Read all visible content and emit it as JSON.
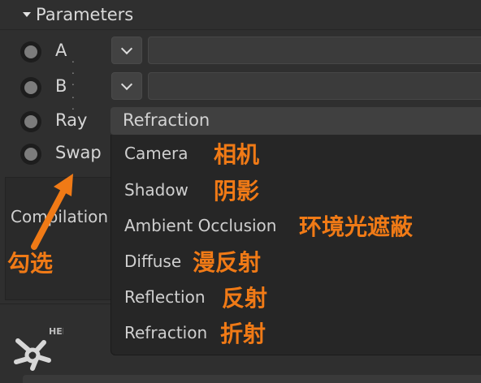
{
  "header": {
    "title": "Parameters"
  },
  "params": [
    {
      "label": "A",
      "dots": ". . ."
    },
    {
      "label": "B",
      "dots": ". . ."
    },
    {
      "label": "Ray"
    },
    {
      "label": "Swap"
    }
  ],
  "ray_select": {
    "value": "Refraction"
  },
  "compilation": {
    "label": "Compilation"
  },
  "dropdown": {
    "options": [
      {
        "label": "Camera",
        "zh": "相机"
      },
      {
        "label": "Shadow",
        "zh": "阴影"
      },
      {
        "label": "Ambient Occlusion",
        "zh": "环境光遮蔽"
      },
      {
        "label": "Diffuse",
        "zh": "漫反射"
      },
      {
        "label": "Reflection",
        "zh": "反射"
      },
      {
        "label": "Refraction",
        "zh": "折射"
      }
    ]
  },
  "annotation": {
    "text": "勾选",
    "color": "#f07a16"
  },
  "help": {
    "label": "HELP"
  },
  "colors": {
    "accent": "#f07a16",
    "background": "#2f2f2f",
    "menu": "#262626"
  }
}
